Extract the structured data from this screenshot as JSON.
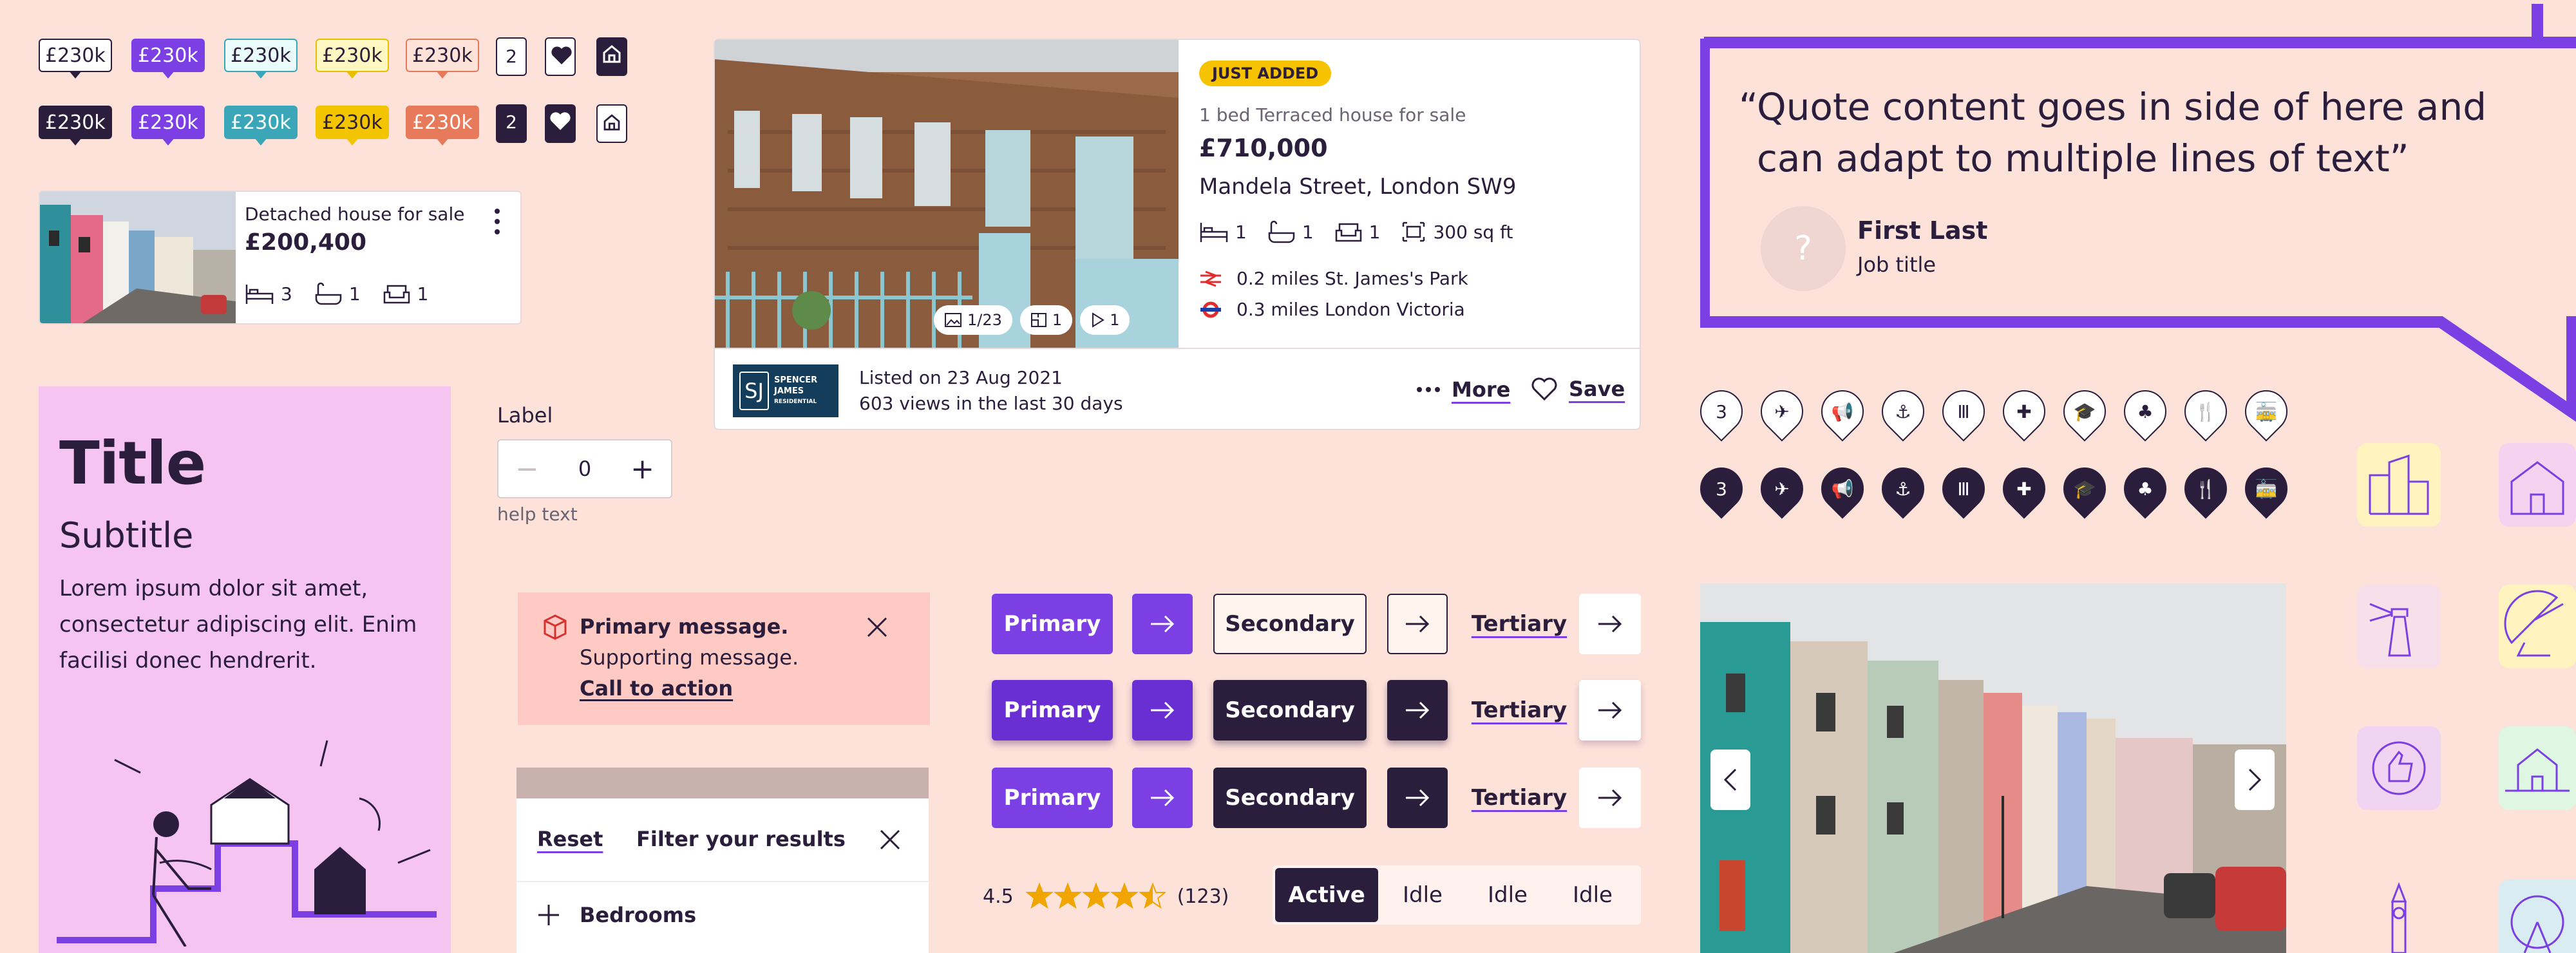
{
  "price_pins": {
    "outline": [
      "£230k",
      "£230k",
      "£230k",
      "£230k",
      "£230k"
    ],
    "filled": [
      "£230k",
      "£230k",
      "£230k",
      "£230k",
      "£230k"
    ],
    "count_outline": "2",
    "count_filled": "2",
    "colors": [
      "#2a1e3c",
      "#7b3fe4",
      "#3aa6b8",
      "#f3c500",
      "#e77a5a"
    ]
  },
  "mini_card": {
    "type": "Detached house for sale",
    "price": "£200,400",
    "beds": "3",
    "baths": "1",
    "receptions": "1"
  },
  "content_card": {
    "title": "Title",
    "subtitle": "Subtitle",
    "body": "Lorem ipsum dolor sit amet, consectetur adipiscing elit. Enim facilisi donec hendrerit."
  },
  "stepper": {
    "label": "Label",
    "value": "0",
    "help": "help text"
  },
  "listing": {
    "badge": "JUST ADDED",
    "type": "1 bed Terraced house for sale",
    "price": "£710,000",
    "address": "Mandela Street, London SW9",
    "beds": "1",
    "baths": "1",
    "receptions": "1",
    "area": "300 sq ft",
    "station1": "0.2 miles St. James's Park",
    "station2": "0.3 miles London Victoria",
    "photos": "1/23",
    "floorplans": "1",
    "videos": "1",
    "listed": "Listed on 23 Aug 2021",
    "views": "603 views in the last 30 days",
    "more": "More",
    "save": "Save",
    "agent_line1": "SPENCER",
    "agent_line2": "JAMES",
    "agent_line3": "RESIDENTIAL"
  },
  "quote": {
    "text": "“Quote content goes in side of here and can adapt to multiple lines of text”",
    "name": "First Last",
    "role": "Job title",
    "avatar": "?"
  },
  "alert": {
    "title": "Primary message.",
    "support": "Supporting message.",
    "cta": "Call to action"
  },
  "buttons": {
    "primary": "Primary",
    "secondary": "Secondary",
    "tertiary": "Tertiary"
  },
  "filter": {
    "reset": "Reset",
    "title": "Filter your results",
    "row": "Bedrooms"
  },
  "rating": {
    "score": "4.5",
    "count": "(123)",
    "value": 4.5
  },
  "segmented": [
    "Active",
    "Idle",
    "Idle",
    "Idle"
  ],
  "map_markers": {
    "count": "3",
    "icons": [
      "number",
      "plane-icon",
      "megaphone-icon",
      "anchor-icon",
      "dumbbell-icon",
      "medical-icon",
      "graduation-icon",
      "park-icon",
      "restaurant-icon",
      "tram-icon"
    ]
  }
}
